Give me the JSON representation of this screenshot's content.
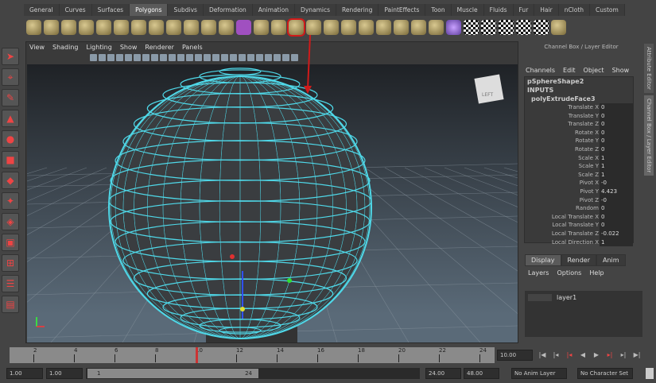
{
  "shelf": {
    "tabs": [
      "General",
      "Curves",
      "Surfaces",
      "Polygons",
      "Subdivs",
      "Deformation",
      "Animation",
      "Dynamics",
      "Rendering",
      "PaintEffects",
      "Toon",
      "Muscle",
      "Fluids",
      "Fur",
      "Hair",
      "nCloth",
      "Custom"
    ],
    "active": "Polygons",
    "highlighted_icon": "extrude-face-icon",
    "highlight_color": "#d01a1a"
  },
  "viewport": {
    "menu": [
      "View",
      "Shading",
      "Lighting",
      "Show",
      "Renderer",
      "Panels"
    ],
    "viewcube_label": "LEFT",
    "wire_color": "#4fd8e8"
  },
  "channel_box": {
    "title": "Channel Box / Layer Editor",
    "menu": [
      "Channels",
      "Edit",
      "Object",
      "Show"
    ],
    "shape": "pSphereShape2",
    "inputs": "INPUTS",
    "node": "polyExtrudeFace3",
    "channels": [
      [
        "Translate X",
        "0"
      ],
      [
        "Translate Y",
        "0"
      ],
      [
        "Translate Z",
        "0"
      ],
      [
        "Rotate X",
        "0"
      ],
      [
        "Rotate Y",
        "0"
      ],
      [
        "Rotate Z",
        "0"
      ],
      [
        "Scale X",
        "1"
      ],
      [
        "Scale Y",
        "1"
      ],
      [
        "Scale Z",
        "1"
      ],
      [
        "Pivot X",
        "-0"
      ],
      [
        "Pivot Y",
        "4.423"
      ],
      [
        "Pivot Z",
        "-0"
      ],
      [
        "Random",
        "0"
      ],
      [
        "Local Translate X",
        "0"
      ],
      [
        "Local Translate Y",
        "0"
      ],
      [
        "Local Translate Z",
        "-0.022"
      ],
      [
        "Local Direction X",
        "1"
      ]
    ]
  },
  "side_tabs": [
    "Attribute Editor",
    "Channel Box / Layer Editor"
  ],
  "layer_editor": {
    "tabs": [
      "Display",
      "Render",
      "Anim"
    ],
    "menu": [
      "Layers",
      "Options",
      "Help"
    ],
    "layers": [
      "layer1"
    ]
  },
  "timeline": {
    "ticks": [
      "2",
      "4",
      "6",
      "8",
      "10",
      "12",
      "14",
      "16",
      "18",
      "20",
      "22",
      "24"
    ],
    "current_time": "10.00"
  },
  "range": {
    "start": "1.00",
    "playback_start": "1.00",
    "slider_start": "1",
    "slider_end": "24",
    "playback_end": "24.00",
    "end": "48.00",
    "anim_layer": "No Anim Layer",
    "character_set": "No Character Set"
  }
}
